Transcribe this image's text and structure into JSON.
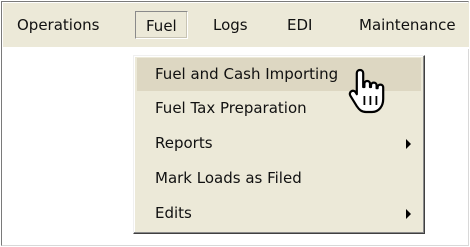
{
  "menubar": {
    "items": [
      {
        "label": "Operations"
      },
      {
        "label": "Fuel"
      },
      {
        "label": "Logs"
      },
      {
        "label": "EDI"
      },
      {
        "label": "Maintenance"
      }
    ],
    "active": "Fuel"
  },
  "fuel_menu": {
    "items": [
      {
        "label": "Fuel and Cash Importing",
        "submenu": false,
        "hovered": true
      },
      {
        "label": "Fuel Tax Preparation",
        "submenu": false
      },
      {
        "label": "Reports",
        "submenu": true
      },
      {
        "label": "Mark Loads as Filed",
        "submenu": false
      },
      {
        "label": "Edits",
        "submenu": true
      }
    ]
  },
  "icons": {
    "cursor": "hand-pointer-icon",
    "submenu_arrow": "chevron-right-icon"
  },
  "colors": {
    "menu_background": "#ece9d8",
    "hover_background": "#ddd7c2"
  }
}
